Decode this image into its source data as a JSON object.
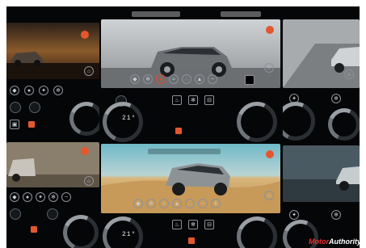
{
  "screen_top": {
    "gauge_readout": "21°"
  },
  "screen_bottom": {
    "gauge_readout": "21°"
  },
  "watermark": {
    "brand": "Motor",
    "suffix": "Authority"
  },
  "colors": {
    "accent_orange": "#e4572e",
    "selected_red": "#e24a2c",
    "background": "#050608",
    "sand": "#d9b67a",
    "sky_teal": "#6fb9c8"
  },
  "icons": [
    "terrain-mode-icon",
    "camera-icon",
    "settings-icon",
    "climate-icon",
    "suspension-icon",
    "wade-icon",
    "home-icon"
  ]
}
